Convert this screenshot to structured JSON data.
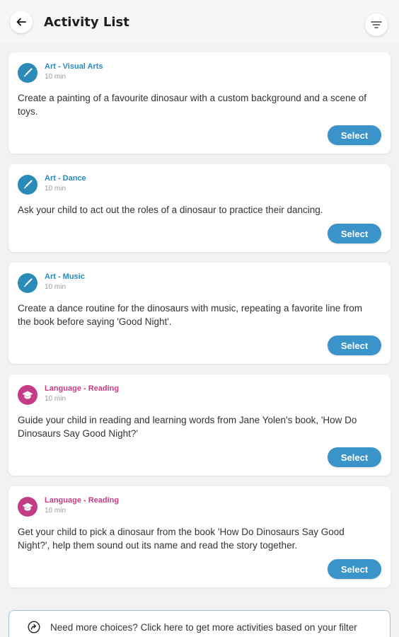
{
  "header": {
    "title": "Activity List",
    "back_icon": "arrow-left-icon",
    "filter_icon": "filter-icon"
  },
  "colors": {
    "art": "#2a8ab8",
    "language": "#c23d86",
    "select_button": "#3a93c9"
  },
  "activities": [
    {
      "category": "Art - Visual Arts",
      "kind": "art",
      "icon": "paintbrush-icon",
      "duration": "10 min",
      "description": "Create a painting of a favourite dinosaur with a custom background and a scene of toys.",
      "select_label": "Select"
    },
    {
      "category": "Art - Dance",
      "kind": "art",
      "icon": "paintbrush-icon",
      "duration": "10 min",
      "description": "Ask your child to act out the roles of a dinosaur to practice their dancing.",
      "select_label": "Select"
    },
    {
      "category": "Art - Music",
      "kind": "art",
      "icon": "paintbrush-icon",
      "duration": "10 min",
      "description": "Create a dance routine for the dinosaurs with music, repeating a favorite line from the book before saying 'Good Night'.",
      "select_label": "Select"
    },
    {
      "category": "Language - Reading",
      "kind": "language",
      "icon": "graduation-cap-icon",
      "duration": "10 min",
      "description": "Guide your child in reading and learning words from Jane Yolen's book, 'How Do Dinosaurs Say Good Night?'",
      "select_label": "Select"
    },
    {
      "category": "Language - Reading",
      "kind": "language",
      "icon": "graduation-cap-icon",
      "duration": "10 min",
      "description": "Get your child to pick a dinosaur from the book 'How Do Dinosaurs Say Good Night?', help them sound out its name and read the story together.",
      "select_label": "Select"
    }
  ],
  "more_choices": {
    "icon": "share-arrow-icon",
    "text": "Need more choices? Click here to get more activities based on your filter"
  }
}
